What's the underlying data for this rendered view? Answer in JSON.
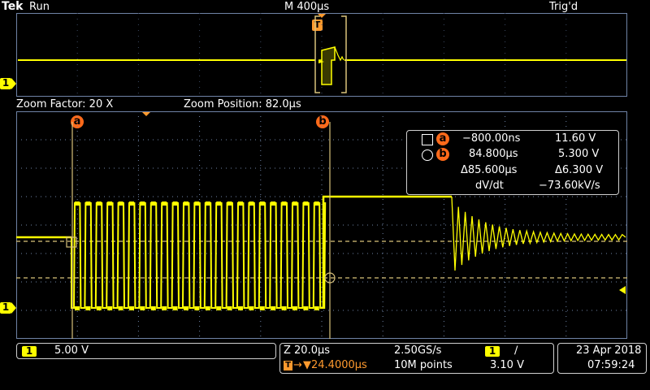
{
  "header": {
    "brand": "Tek",
    "run_state": "Run",
    "timebase": "M 400µs",
    "trigger_status": "Trig'd"
  },
  "zoom_bar": {
    "factor_label": "Zoom Factor: 20 X",
    "position_label": "Zoom Position: 82.0µs"
  },
  "markers": {
    "trigger_marker": "T",
    "channel_marker": "1",
    "cursor_a": "a",
    "cursor_b": "b"
  },
  "measurements": {
    "rows": [
      {
        "label": "a",
        "time": "−800.00ns",
        "value": "11.60 V"
      },
      {
        "label": "b",
        "time": "84.800µs",
        "value": "5.300 V"
      },
      {
        "label": "Δ",
        "time": "Δ85.600µs",
        "value": "Δ6.300 V"
      },
      {
        "label": "dV/dt",
        "time": "dV/dt",
        "value": "−73.60kV/s"
      }
    ]
  },
  "status_bar": {
    "channel_number": "1",
    "channel_scale": "5.00 V",
    "zoom_scale": "Z 20.0µs",
    "sample_rate": "2.50GS/s",
    "trigger_channel": "1",
    "trigger_slope": "∕",
    "trigger_offset": "▼24.4000µs",
    "record_length": "10M points",
    "trigger_level": "3.10 V",
    "date": "23 Apr  2018",
    "time": "07:59:24"
  },
  "colors": {
    "trace": "#ffff00",
    "accent": "#ff9a2e",
    "cursor_badge": "#ff6a1a",
    "grid": "#6f83a6",
    "background": "#000000"
  }
}
